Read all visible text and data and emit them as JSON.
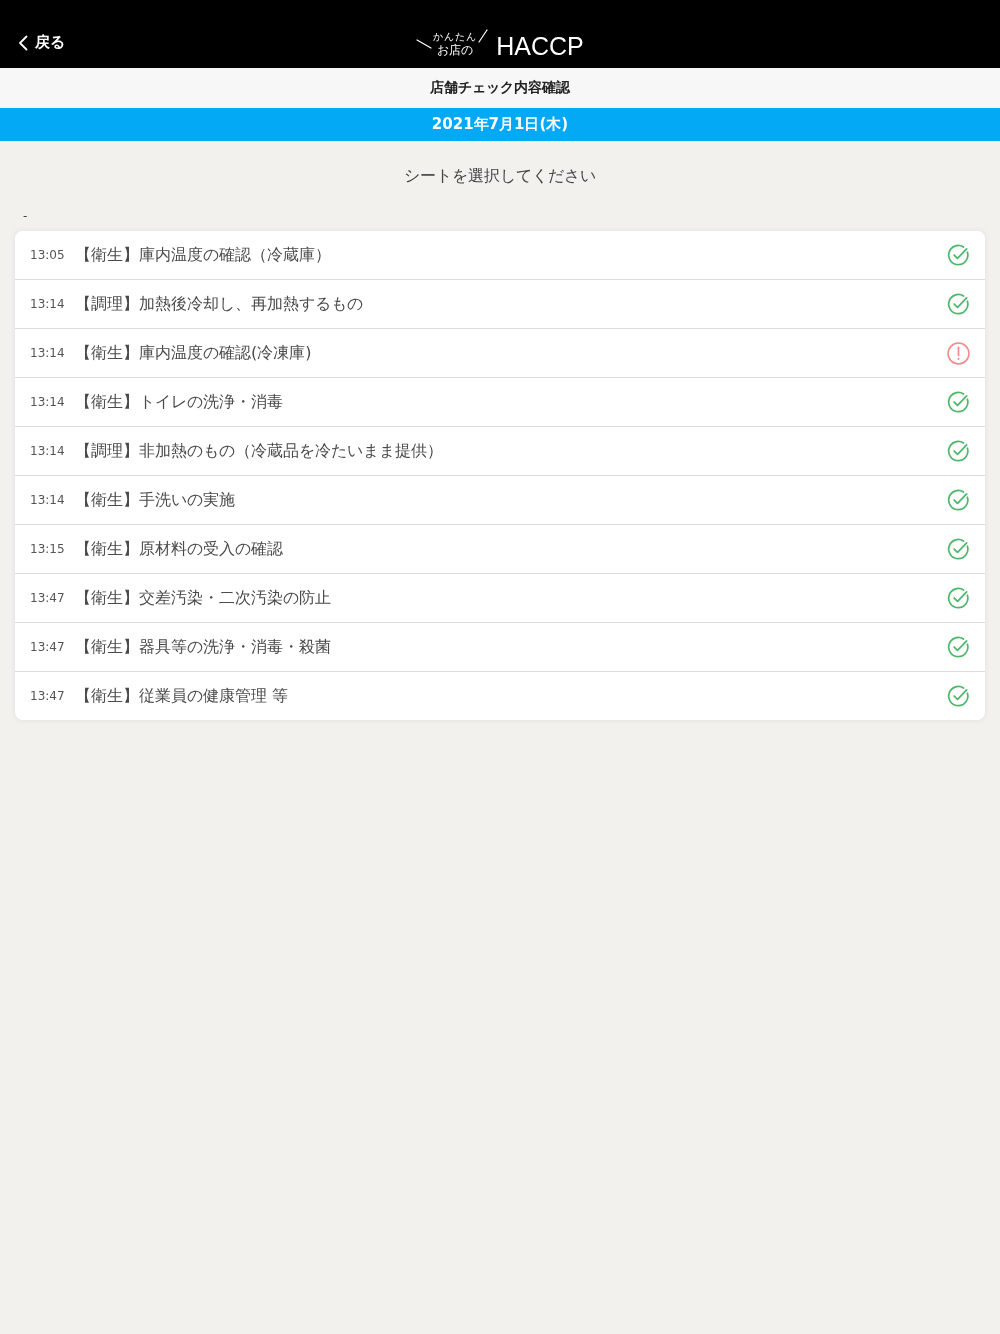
{
  "header": {
    "back_label": "戻る",
    "logo": {
      "ruby": "かんたん",
      "main": "お店の",
      "brand": "HACCP"
    }
  },
  "subtitle": "店舗チェック内容確認",
  "date_bar": "2021年7月1日(木)",
  "instruction": "シートを選択してください",
  "group_label": "-",
  "sheets": [
    {
      "time": "13:05",
      "title": "【衛生】庫内温度の確認（冷蔵庫）",
      "checked": true
    },
    {
      "time": "13:14",
      "title": "【調理】加熱後冷却し、再加熱するもの",
      "checked": true
    },
    {
      "time": "13:14",
      "title": "【衛生】庫内温度の確認(冷凍庫)",
      "checked": false
    },
    {
      "time": "13:14",
      "title": "【衛生】トイレの洗浄・消毒",
      "checked": true
    },
    {
      "time": "13:14",
      "title": "【調理】非加熱のもの（冷蔵品を冷たいまま提供）",
      "checked": true
    },
    {
      "time": "13:14",
      "title": "【衛生】手洗いの実施",
      "checked": true
    },
    {
      "time": "13:15",
      "title": "【衛生】原材料の受入の確認",
      "checked": true
    },
    {
      "time": "13:47",
      "title": "【衛生】交差汚染・二次汚染の防止",
      "checked": true
    },
    {
      "time": "13:47",
      "title": "【衛生】器具等の洗浄・消毒・殺菌",
      "checked": true
    },
    {
      "time": "13:47",
      "title": "【衛生】従業員の健康管理 等",
      "checked": true
    }
  ]
}
